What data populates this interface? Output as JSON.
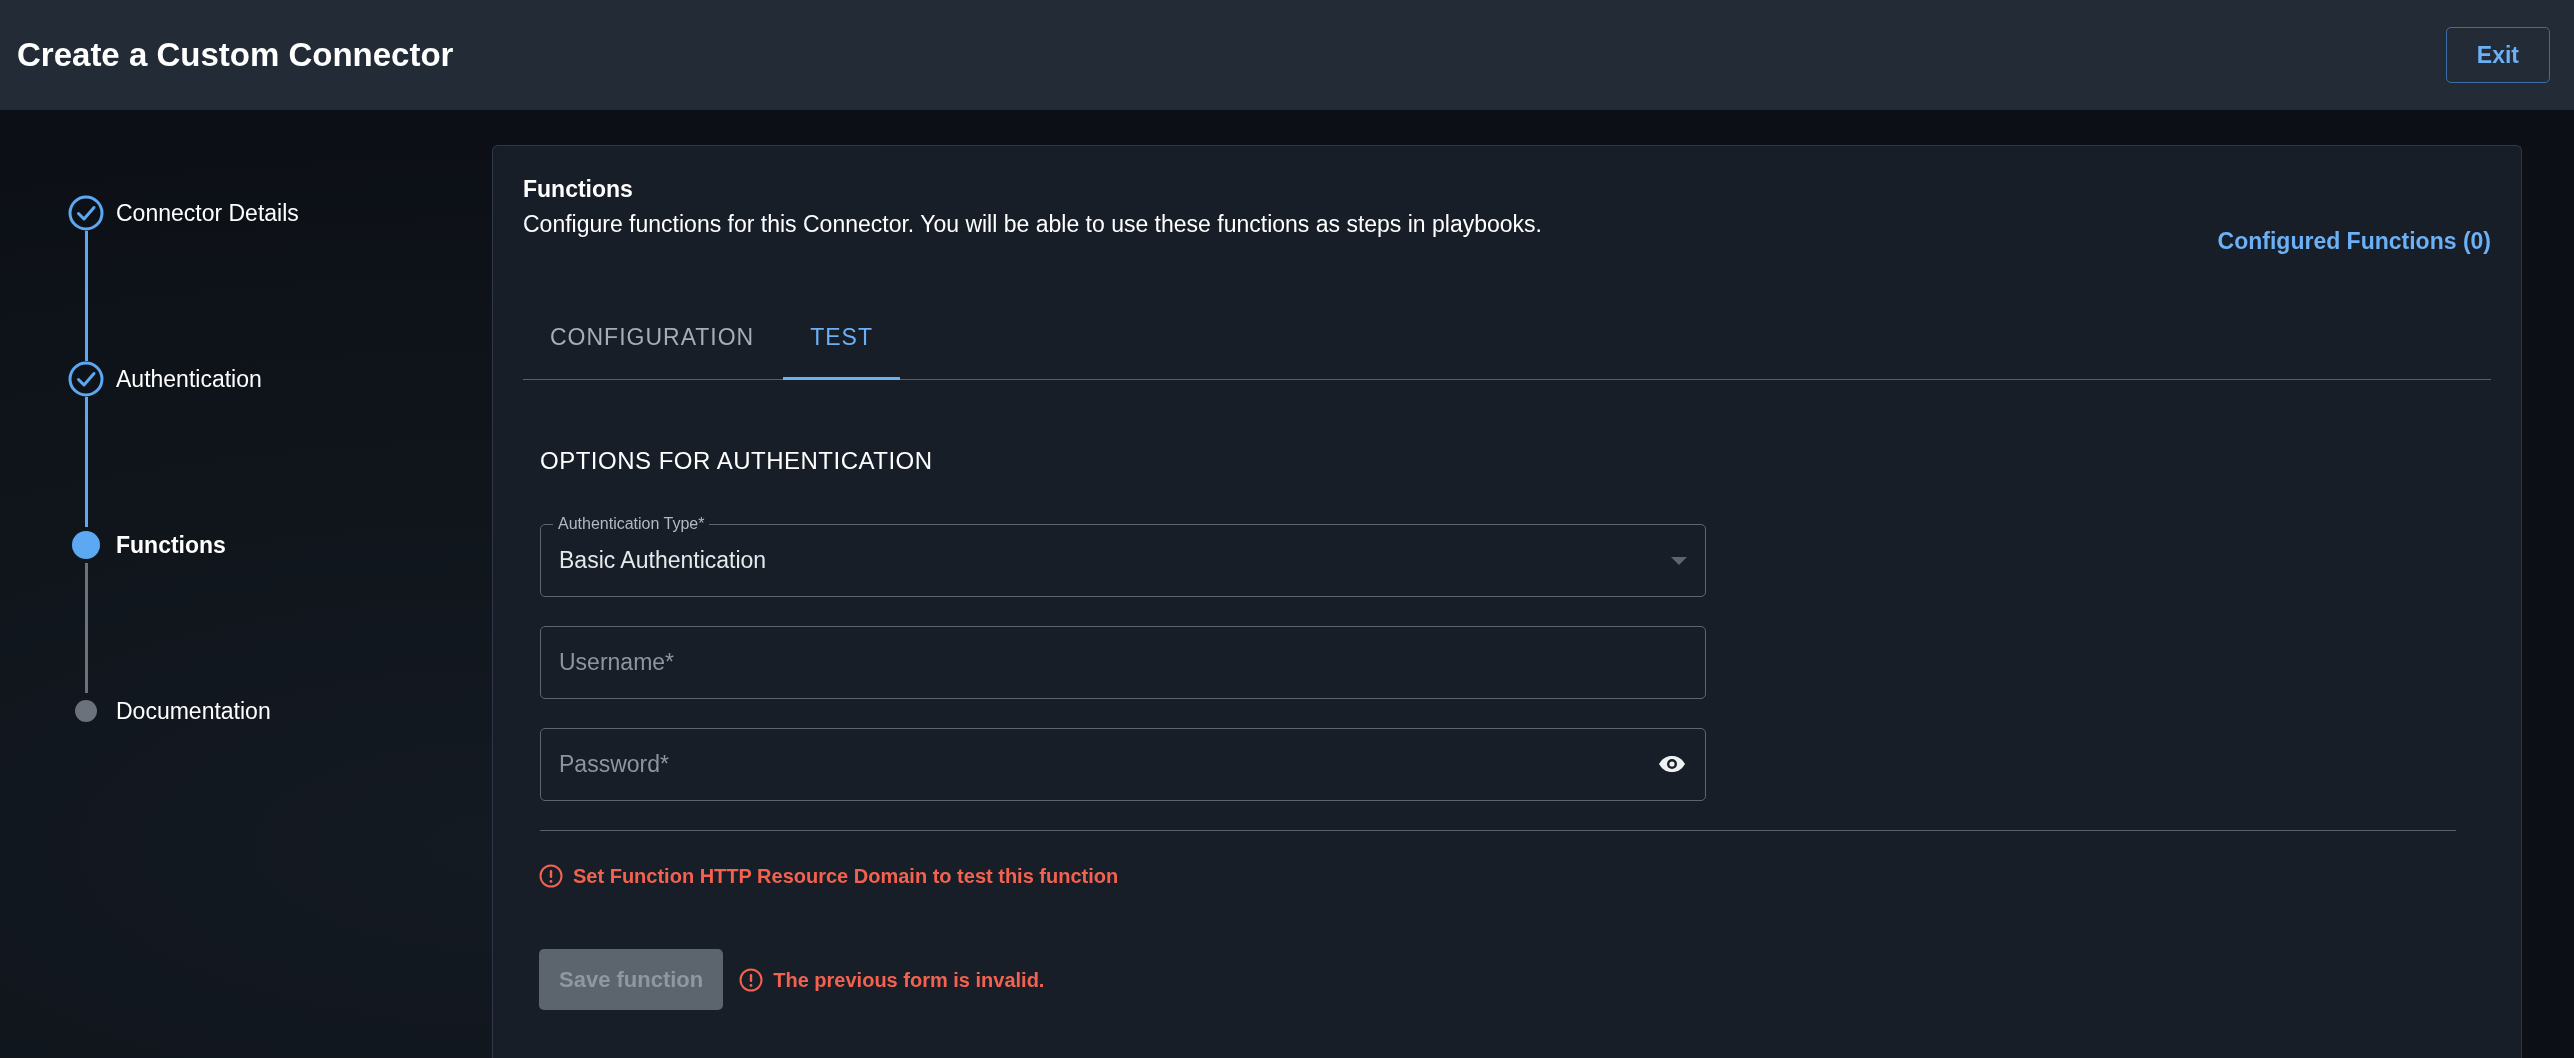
{
  "header": {
    "title": "Create a Custom Connector",
    "exit_button": "Exit"
  },
  "steps": [
    {
      "label": "Connector Details",
      "completed": true,
      "selected": false
    },
    {
      "label": "Authentication",
      "completed": true,
      "selected": false
    },
    {
      "label": "Functions",
      "completed": false,
      "selected": true
    },
    {
      "label": "Documentation",
      "completed": false,
      "selected": false
    }
  ],
  "panel": {
    "title": "Functions",
    "description": "Configure functions for this Connector. You will be able to use these functions as steps in playbooks.",
    "configured_link": "Configured Functions (0)",
    "tabs": [
      {
        "label": "CONFIGURATION",
        "selected": false
      },
      {
        "label": "TEST",
        "selected": true
      }
    ],
    "section_title": "OPTIONS FOR AUTHENTICATION",
    "fields": [
      {
        "kind": "select",
        "label": "Authentication Type*",
        "value": "Basic Authentication"
      },
      {
        "kind": "text",
        "placeholder": "Username*"
      },
      {
        "kind": "password",
        "placeholder": "Password*"
      }
    ],
    "domain_error": "Set Function HTTP Resource Domain to test this function",
    "save_button": {
      "label": "Save function",
      "disabled": true
    },
    "form_error": "The previous form is invalid."
  }
}
